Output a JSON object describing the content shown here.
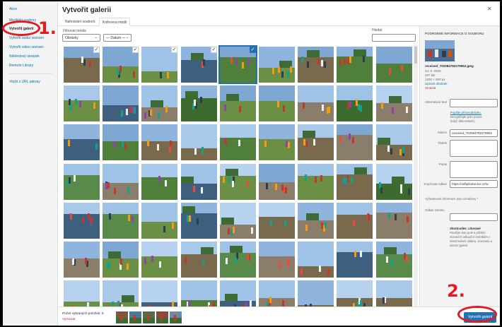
{
  "colors": {
    "accent": "#2271b1",
    "annotation": "#e21b23",
    "delete": "#b32d2e",
    "link": "#0073aa"
  },
  "sidebar": {
    "items": [
      {
        "label": "Akce"
      },
      {
        "label": "Mediální soubory"
      },
      {
        "label": "Vytvořit galerii"
      },
      {
        "label": "Vytvořit audio seznam"
      },
      {
        "label": "Vytvořit video seznam"
      },
      {
        "label": "Náhledový obrázek"
      },
      {
        "label": "Remote Library"
      },
      {
        "label": "Vložit z URL adresy"
      }
    ],
    "active_index": 2
  },
  "header": {
    "title": "Vytvořit galerii",
    "close_icon": "close-icon"
  },
  "tabs": [
    {
      "label": "Nahrávání souborů"
    },
    {
      "label": "Knihovna médií"
    }
  ],
  "filters": {
    "label": "Filtrovat média",
    "type_value": "Obrázky",
    "date_value": "— Datum —",
    "search_label": "Hledat",
    "search_placeholder": ""
  },
  "grid": {
    "rows": 7,
    "cols": 9,
    "selected_indices": [
      0,
      1,
      2,
      3,
      4
    ],
    "current_index": 4
  },
  "details": {
    "heading": "Podrobné informace o souboru",
    "filename": "received_702084792279952.jpeg",
    "date": "24. 6. 2020",
    "filesize": "297 kB",
    "dimensions": "1200 × 900 px",
    "edit_link": "Upravit obrázek",
    "delete_link": "Smazat",
    "alt_label": "Alternativní text",
    "alt_value": "",
    "alt_help_link": "Popište přínosobrázku.",
    "alt_help_text": "Nevyplňujte pole pouze",
    "alt_help_text2": "(když dekorativní).",
    "title_label": "Název",
    "title_value": "received_702084792279952",
    "caption_label": "Titulek",
    "description_label": "Popis",
    "url_label": "Kopírovat odkaz",
    "url_value": "https://odhplrukonice.cz/w",
    "required_label": "Vyžadované informace jsou označeny *",
    "source_label": "Odkaz snímku",
    "source_value": "",
    "shortcode_title": "Shortcodes: citované",
    "shortcode_text": [
      "Použijte toto pole k přidání",
      "vlastních odkazů k snímkům v",
      "shortcodech slideru, Karuselu a",
      "vlastní galerii"
    ]
  },
  "footer": {
    "count_text": "Počet vybraných položek: 5",
    "clear_link": "Vymazat",
    "create_button": "Vytvořit galerii"
  },
  "annotations": {
    "step1": "1.",
    "step2": "2."
  }
}
